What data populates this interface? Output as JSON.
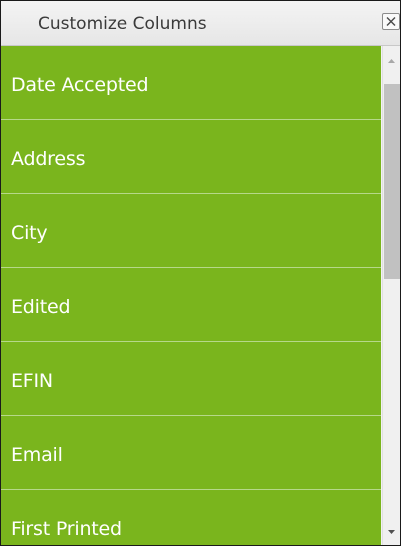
{
  "dialog": {
    "title": "Customize Columns",
    "close_icon": "close-icon"
  },
  "columns": [
    {
      "label": "Date Accepted"
    },
    {
      "label": "Address"
    },
    {
      "label": "City"
    },
    {
      "label": "Edited"
    },
    {
      "label": "EFIN"
    },
    {
      "label": "Email"
    },
    {
      "label": "First Printed"
    }
  ],
  "colors": {
    "item_background": "#7ab51d",
    "item_text": "#ffffff",
    "item_divider": "#b6d889",
    "title_text": "#3a3a3a"
  },
  "scrollbar": {
    "up_icon": "scroll-up-arrow-icon",
    "down_icon": "scroll-down-arrow-icon"
  }
}
